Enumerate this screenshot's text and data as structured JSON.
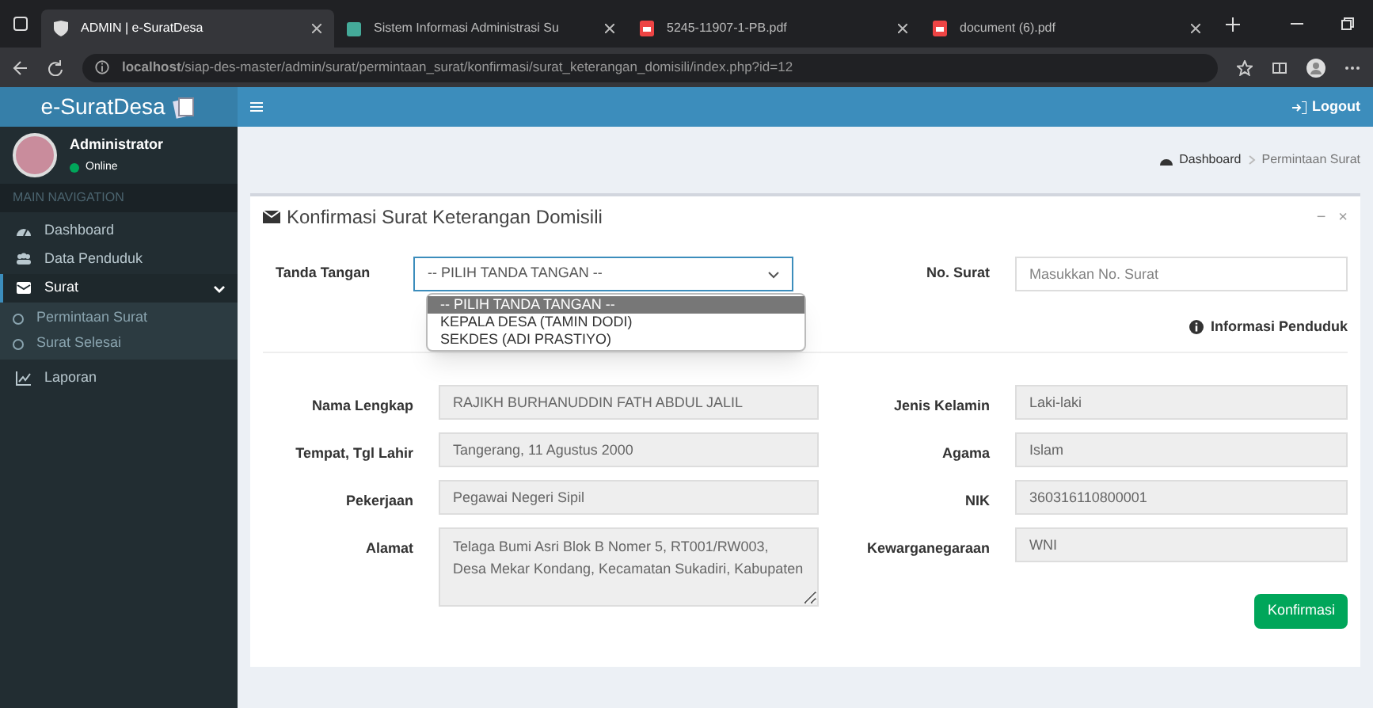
{
  "browser": {
    "tabs": [
      {
        "title": "ADMIN | e-SuratDesa",
        "kind": "page",
        "selected": true
      },
      {
        "title": "Sistem Informasi Administrasi Su",
        "kind": "page",
        "selected": false
      },
      {
        "title": "5245-11907-1-PB.pdf",
        "kind": "pdf",
        "selected": false
      },
      {
        "title": "document (6).pdf",
        "kind": "pdf",
        "selected": false
      }
    ],
    "address": "**localhost**/siap-des-master/admin/surat/permintaan_surat/konfirmasi/surat_keterangan_domisili/index.php?id=12"
  },
  "app": {
    "logo": "e-SuratDesa",
    "logout": "Logout"
  },
  "sidebar": {
    "user": {
      "name": "Administrator",
      "status": "Online"
    },
    "section": "MAIN NAVIGATION",
    "items": [
      {
        "label": "Dashboard",
        "selected": false
      },
      {
        "label": "Data Penduduk",
        "selected": false
      },
      {
        "label": "Surat",
        "selected": true,
        "expanded": true,
        "children": [
          {
            "label": "Permintaan Surat"
          },
          {
            "label": "Surat Selesai"
          }
        ]
      },
      {
        "label": "Laporan",
        "selected": false
      }
    ]
  },
  "breadcrumb": [
    "Dashboard",
    "Permintaan Surat"
  ],
  "box": {
    "title": "Konfirmasi Surat Keterangan Domisili",
    "minimize": "−",
    "close": "×",
    "tanda_tangan": {
      "label": "Tanda Tangan",
      "value": "-- PILIH TANDA TANGAN --",
      "expanded": true,
      "options": [
        {
          "label": "-- PILIH TANDA TANGAN --",
          "selected": true
        },
        {
          "label": "KEPALA DESA (TAMIN DODI)",
          "selected": false
        },
        {
          "label": "SEKDES (ADI PRASTIYO)",
          "selected": false
        }
      ]
    },
    "no_surat": {
      "label": "No. Surat",
      "placeholder": "Masukkan No. Surat"
    },
    "info_heading": "Informasi Penduduk",
    "left_fields": [
      {
        "label": "Nama Lengkap",
        "value": "RAJIKH BURHANUDDIN FATH ABDUL JALIL",
        "kind": "input"
      },
      {
        "label": "Tempat, Tgl Lahir",
        "value": "Tangerang, 11 Agustus 2000",
        "kind": "input"
      },
      {
        "label": "Pekerjaan",
        "value": "Pegawai Negeri Sipil",
        "kind": "input"
      },
      {
        "label": "Alamat",
        "value": "Telaga Bumi Asri Blok B Nomer 5, RT001/RW003, Desa Mekar Kondang, Kecamatan Sukadiri, Kabupaten",
        "kind": "textarea"
      }
    ],
    "right_fields": [
      {
        "label": "Jenis Kelamin",
        "value": "Laki-laki",
        "kind": "input"
      },
      {
        "label": "Agama",
        "value": "Islam",
        "kind": "input"
      },
      {
        "label": "NIK",
        "value": "360316110800001",
        "kind": "input"
      },
      {
        "label": "Kewarganegaraan",
        "value": "WNI",
        "kind": "input"
      }
    ],
    "submit": "Konfirmasi"
  }
}
